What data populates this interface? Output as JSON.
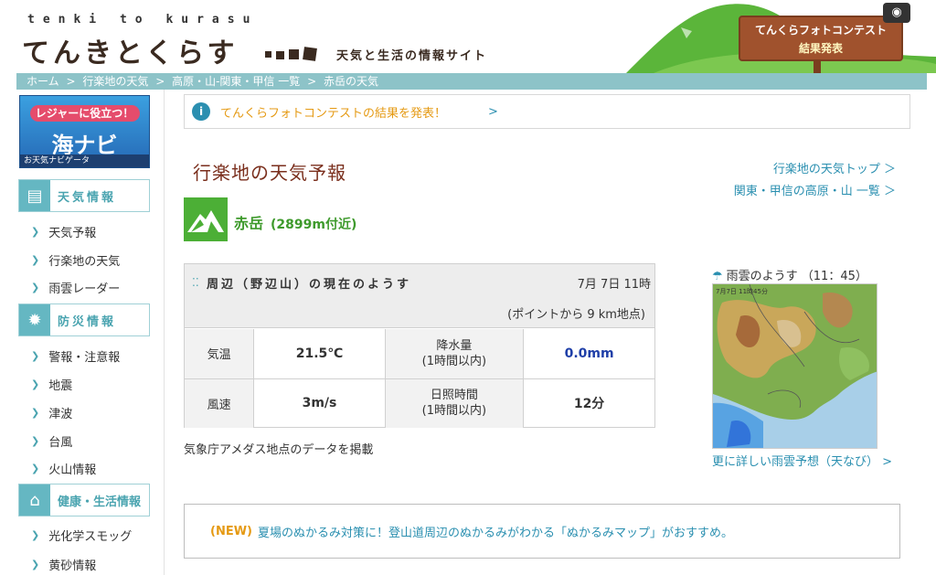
{
  "header": {
    "logo_roman": "tenki to kurasu",
    "logo_main": "てんきとくらす",
    "tagline": "天気と生活の情報サイト",
    "promo_line1": "てんくらフォトコンテスト",
    "promo_line2": "結果発表"
  },
  "breadcrumb": [
    "ホーム",
    ">",
    "行楽地の天気",
    ">",
    "高原・山-関東・甲信 一覧",
    ">",
    "赤岳の天気"
  ],
  "sidebar": {
    "banner_top": "レジャーに役立つ！",
    "banner_main": "海ナビ",
    "banner_foot": "お天気ナビゲータ",
    "sections": [
      {
        "title": "天気情報",
        "items": [
          "天気予報",
          "行楽地の天気",
          "雨雲レーダー"
        ]
      },
      {
        "title": "防災情報",
        "items": [
          "警報・注意報",
          "地震",
          "津波",
          "台風",
          "火山情報"
        ]
      },
      {
        "title": "健康・生活情報",
        "items": [
          "光化学スモッグ",
          "黄砂情報"
        ]
      }
    ]
  },
  "notice": {
    "icon": "i",
    "text": "てんくらフォトコンテストの結果を発表！",
    "arrow": ">"
  },
  "main": {
    "title": "行楽地の天気予報",
    "links": [
      "行楽地の天気トップ ＞",
      "関東・甲信の高原・山 一覧 ＞"
    ],
    "peak_name": "赤岳",
    "peak_alt": "(2899m付近)"
  },
  "observation": {
    "title": "周辺（野辺山）の現在のようす",
    "date": "7月 7日 11時",
    "point": "(ポイントから 9 km地点)",
    "rows": [
      {
        "label": "気温",
        "value": "21.5℃",
        "label2": "降水量\n(1時間以内)",
        "value2": "0.0mm"
      },
      {
        "label": "風速",
        "value": "3m/s",
        "label2": "日照時間\n(1時間以内)",
        "value2": "12分"
      }
    ],
    "note": "気象庁アメダス地点のデータを掲載"
  },
  "rain": {
    "title": "雨雲のようす （11：45）",
    "stamp": "7月7日 11時45分",
    "link": "更に詳しい雨雲予想（天なび） >"
  },
  "news": {
    "tag": "(NEW)",
    "text": "夏場のぬかるみ対策に！登山道周辺のぬかるみがわかる「ぬかるみマップ」がおすすめ。"
  },
  "colors": {
    "accent": "#4aa4b0",
    "title": "#7a2e1c",
    "peak_green": "#4caf36",
    "link": "#2a8fb0",
    "orange": "#e59a14"
  }
}
